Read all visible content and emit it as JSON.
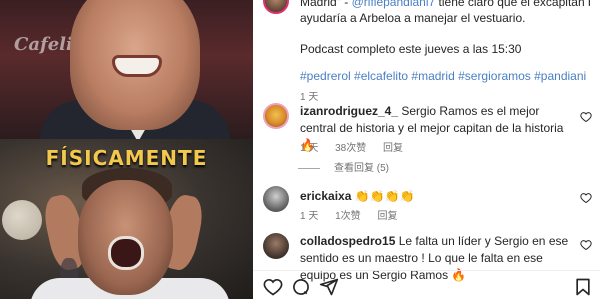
{
  "post": {
    "caption_line1_prefix": "Madrid\" - ",
    "caption_mention": "@riflepandiani7",
    "caption_line1_suffix": " tiene claro que el excapitán blanco",
    "caption_line2": "ayudaría a Arbeloa a manejar el vestuario.",
    "caption_line3": "Podcast completo este jueves a las 15:30",
    "hashtags": "#pedrerol #elcafelito #madrid #sergioramos #pandiani",
    "time": "1 天"
  },
  "media": {
    "overlay_text": "FÍSICAMENTE",
    "logo_text": "Cafelito"
  },
  "comments": [
    {
      "user": "izanrodriguez_4_",
      "text": "Sergio Ramos es el mejor central de historia y el mejor capitan de la historia 🔥",
      "time": "1 天",
      "likes": "38次赞",
      "reply": "回复",
      "view_replies": "查看回复 (5)"
    },
    {
      "user": "erickaixa",
      "text": "👏👏👏👏",
      "time": "1 天",
      "likes": "1次赞",
      "reply": "回复"
    },
    {
      "user": "colladospedro15",
      "text": "Le falta un líder y Sergio en ese sentido es un maestro ! Lo que le falta en ese equipo es un Sergio Ramos 🔥"
    }
  ],
  "icons": {
    "like": "heart-icon",
    "comment": "comment-icon",
    "share": "share-icon",
    "save": "bookmark-icon"
  },
  "colors": {
    "link": "#4a7fc4",
    "meta": "#737373",
    "caption_accent": "#f2c94c"
  }
}
